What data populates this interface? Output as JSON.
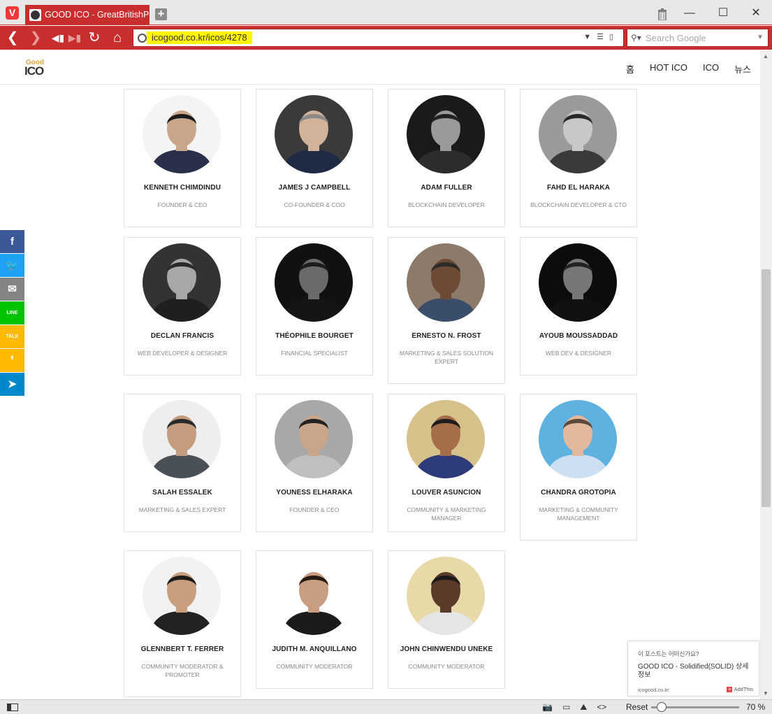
{
  "browser": {
    "logo_letter": "V",
    "tab_title": "GOOD ICO - GreatBritishPou",
    "new_tab": "+",
    "url": "icogood.co.kr/icos/4278",
    "search_placeholder": "Search Google",
    "zoom_reset": "Reset",
    "zoom_level": "70 %",
    "accent": "#c92e2e"
  },
  "site": {
    "logo_top": "Good",
    "logo_bottom": "ICO",
    "menu": [
      "홈",
      "HOT ICO",
      "ICO",
      "뉴스"
    ]
  },
  "team": [
    {
      "name": "KENNETH CHIMDINDU",
      "role": "FOUNDER & CEO"
    },
    {
      "name": "JAMES J CAMPBELL",
      "role": "CO-FOUNDER & COO"
    },
    {
      "name": "ADAM FULLER",
      "role": "BLOCKCHAIN DEVELOPER"
    },
    {
      "name": "FAHD EL HARAKA",
      "role": "BLOCKCHAIN DEVELOPER & CTO"
    },
    {
      "name": "DECLAN FRANCIS",
      "role": "WEB DEVELOPER & DESIGNER"
    },
    {
      "name": "THÉOPHILE BOURGET",
      "role": "FINANCIAL SPECIALIST"
    },
    {
      "name": "ERNESTO N. FROST",
      "role": "MARKETING & SALES SOLUTION EXPERT"
    },
    {
      "name": "AYOUB MOUSSADDAD",
      "role": "WEB DEV & DESIGNER"
    },
    {
      "name": "SALAH ESSALEK",
      "role": "MARKETING & SALES EXPERT"
    },
    {
      "name": "YOUNESS ELHARAKA",
      "role": "FOUNDER & CEO"
    },
    {
      "name": "LOUVER ASUNCION",
      "role": "COMMUNITY & MARKETING MANAGER"
    },
    {
      "name": "CHANDRA GROTOPIA",
      "role": "MARKETING & COMMUNITY MANAGEMENT"
    },
    {
      "name": "GLENNBERT T. FERRER",
      "role": "COMMUNITY MODERATOR & PROMOTER"
    },
    {
      "name": "JUDITH M. ANQUILLANO",
      "role": "COMMUNITY MODERATOR"
    },
    {
      "name": "JOHN CHINWENDU UNEKE",
      "role": "COMMUNITY MODERATOR"
    }
  ],
  "share": [
    {
      "icon": "facebook-icon",
      "glyph": "f",
      "color": "#3b5998"
    },
    {
      "icon": "twitter-icon",
      "glyph": "🐦",
      "color": "#1da1f2"
    },
    {
      "icon": "email-icon",
      "glyph": "✉",
      "color": "#848484"
    },
    {
      "icon": "line-icon",
      "glyph": "LINE",
      "color": "#00c300"
    },
    {
      "icon": "kakaotalk-icon",
      "glyph": "TALK",
      "color": "#ffb900"
    },
    {
      "icon": "kakaostory-icon",
      "glyph": "❜",
      "color": "#ffb900"
    },
    {
      "icon": "telegram-icon",
      "glyph": "➤",
      "color": "#0088cc"
    }
  ],
  "addthis": {
    "question": "이 포스트는 어떠신가요?",
    "title": "GOOD ICO - Solidified(SOLID) 상세 정보",
    "domain": "icogood.co.kr",
    "brand": "AddThis"
  }
}
